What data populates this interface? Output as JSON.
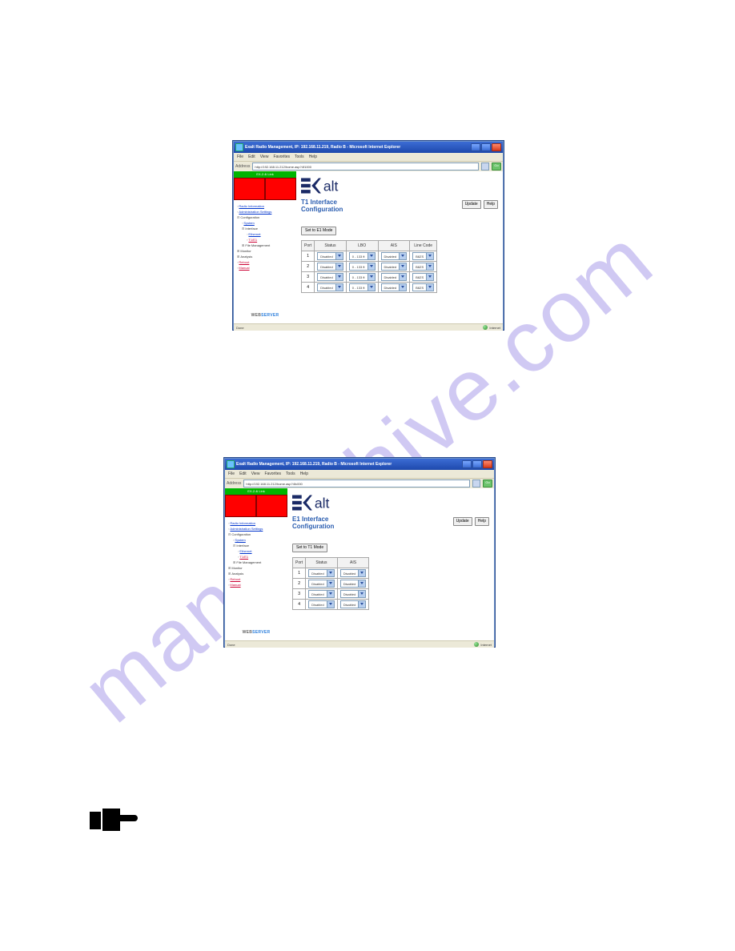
{
  "watermark": "manualshive.com",
  "window_t1": {
    "title": "Exalt Radio Management, IP: 192.168.11.219, Radio B - Microsoft Internet Explorer",
    "menu": [
      "File",
      "Edit",
      "View",
      "Favorites",
      "Tools",
      "Help"
    ],
    "address_label": "Address",
    "address_url": "http://192.168.11.212/home.asp?4f1000",
    "go": "Go",
    "greenbar": "EX-2.4i Link",
    "red_left": "",
    "red_right": "",
    "nav": {
      "radio_info": "Radio Information",
      "admin": "Administration Settings",
      "config": "Configuration",
      "system": "System",
      "interface": "Interface",
      "ethernet": "Ethernet",
      "t1e1": "T1/E1",
      "filemgmt": "File Management",
      "monitor": "Monitor",
      "analysis": "Analysis",
      "reboot": "Reboot",
      "manual": "Manual"
    },
    "section_title_l1": "T1 Interface",
    "section_title_l2": "Configuration",
    "update": "Update",
    "help": "Help",
    "mode_btn": "Set to E1 Mode",
    "headers": {
      "port": "Port",
      "status": "Status",
      "lbo": "LBO",
      "ais": "AIS",
      "linecode": "Line Code"
    },
    "rows": [
      {
        "port": "1",
        "status": "Disabled",
        "lbo": "0 - 133 ft",
        "ais": "Disabled",
        "linecode": "B8ZS"
      },
      {
        "port": "2",
        "status": "Disabled",
        "lbo": "0 - 133 ft",
        "ais": "Disabled",
        "linecode": "B8ZS"
      },
      {
        "port": "3",
        "status": "Disabled",
        "lbo": "0 - 133 ft",
        "ais": "Disabled",
        "linecode": "B8ZS"
      },
      {
        "port": "4",
        "status": "Disabled",
        "lbo": "0 - 133 ft",
        "ais": "Disabled",
        "linecode": "B8ZS"
      }
    ],
    "webserver_web": "WEB",
    "webserver_srv": "SERVER",
    "status_left": "Done",
    "status_right": "Internet"
  },
  "window_e1": {
    "title": "Exalt Radio Management, IP: 192.168.11.219, Radio B - Microsoft Internet Explorer",
    "menu": [
      "File",
      "Edit",
      "View",
      "Favorites",
      "Tools",
      "Help"
    ],
    "address_label": "Address",
    "address_url": "http://192.168.11.212/home.asp?4fc000",
    "go": "Go",
    "greenbar": "EX-2.4i Link",
    "red_left": "",
    "red_right": "",
    "nav": {
      "radio_info": "Radio Information",
      "admin": "Administration Settings",
      "config": "Configuration",
      "system": "System",
      "interface": "Interface",
      "ethernet": "Ethernet",
      "t1e1": "T1/E1",
      "filemgmt": "File Management",
      "monitor": "Monitor",
      "analysis": "Analysis",
      "reboot": "Reboot",
      "manual": "Manual"
    },
    "section_title_l1": "E1 Interface",
    "section_title_l2": "Configuration",
    "update": "Update",
    "help": "Help",
    "mode_btn": "Set to T1 Mode",
    "headers": {
      "port": "Port",
      "status": "Status",
      "ais": "AIS"
    },
    "rows": [
      {
        "port": "1",
        "status": "Disabled",
        "ais": "Disabled"
      },
      {
        "port": "2",
        "status": "Disabled",
        "ais": "Disabled"
      },
      {
        "port": "3",
        "status": "Disabled",
        "ais": "Disabled"
      },
      {
        "port": "4",
        "status": "Disabled",
        "ais": "Disabled"
      }
    ],
    "webserver_web": "WEB",
    "webserver_srv": "SERVER",
    "status_left": "Done",
    "status_right": "Internet"
  }
}
